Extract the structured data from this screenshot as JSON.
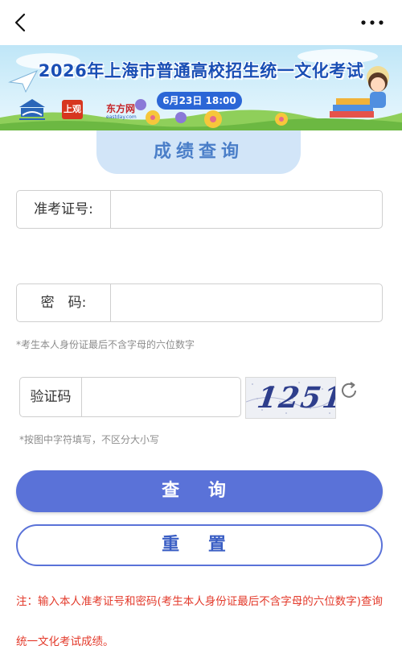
{
  "topbar": {
    "back_icon": "chevron-left-icon",
    "more_icon": "more-dots-icon"
  },
  "banner": {
    "title": "2026年上海市普通高校招生统一文化考试",
    "date": "6月23日 18:00",
    "logo_sg": "上观",
    "logo_df": "东方网",
    "logo_df_sub": "eastday.com"
  },
  "form": {
    "tab_title": "成绩查询",
    "exam_id_label": "准考证号:",
    "exam_id_value": "",
    "password_label": "密　码:",
    "password_value": "",
    "password_hint": "*考生本人身份证最后不含字母的六位数字",
    "captcha_label": "验证码",
    "captcha_value": "",
    "captcha_image_text": "1251",
    "captcha_hint": "*按图中字符填写，不区分大小写",
    "refresh_icon": "refresh-icon"
  },
  "buttons": {
    "query": "查 询",
    "reset": "重 置"
  },
  "note": "注：输入本人准考证号和密码(考生本人身份证最后不含字母的六位数字)查询统一文化考试成绩。",
  "colors": {
    "primary": "#5a72d8",
    "title_blue": "#1a4fb5",
    "tab_bg": "#d2e5f8",
    "note_red": "#e33a2b"
  }
}
